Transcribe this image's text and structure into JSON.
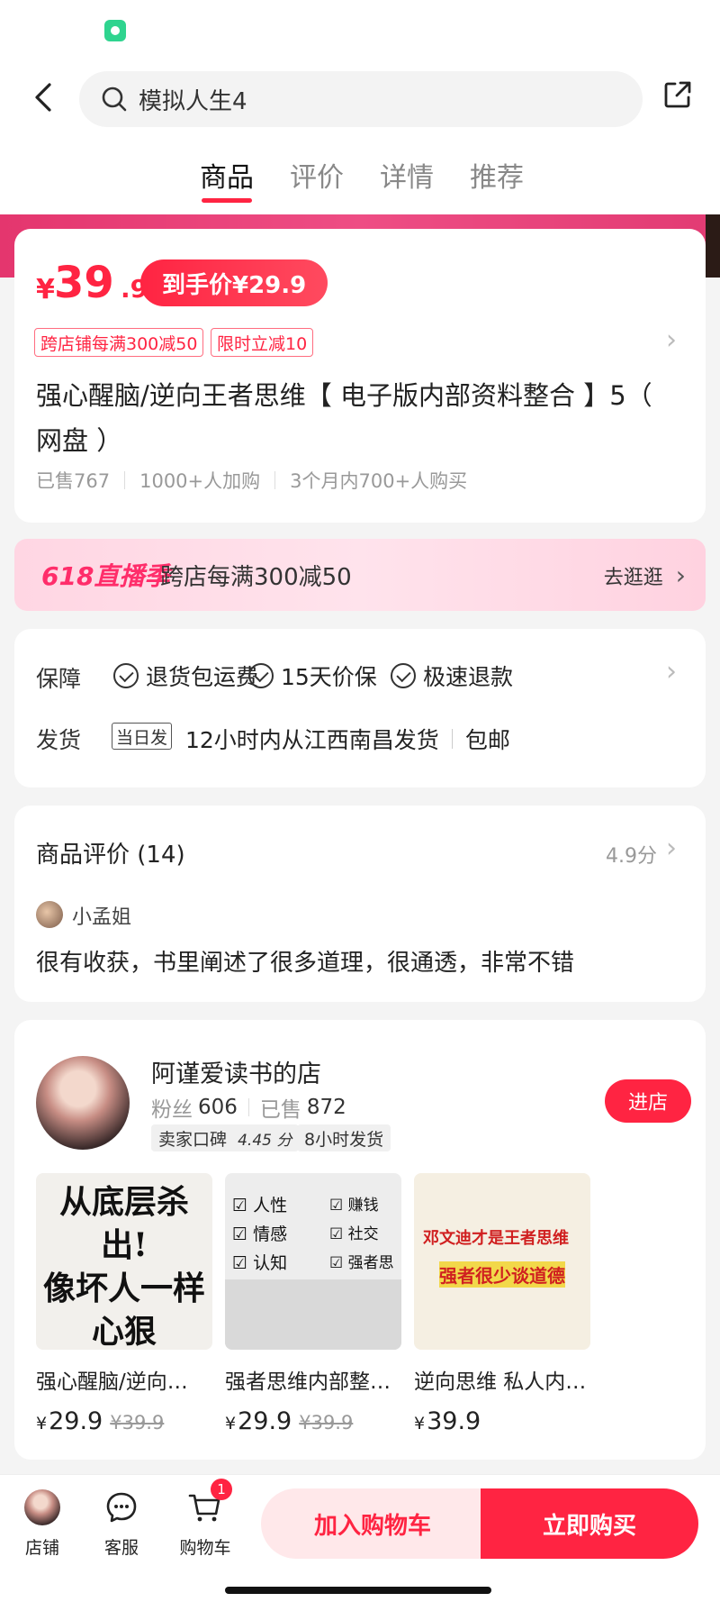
{
  "header": {
    "search_query": "模拟人生4",
    "tabs": [
      "商品",
      "评价",
      "详情",
      "推荐"
    ]
  },
  "price": {
    "currency": "¥",
    "integer": "39",
    "decimal": ".9",
    "final_label": "到手价¥29.9"
  },
  "coupons": [
    "跨店铺每满300减50",
    "限时立减10"
  ],
  "product": {
    "title": "强心醒脑/逆向王者思维【 电子版内部资料整合 】5（ 网盘 ）",
    "stats": [
      "已售767",
      "1000+人加购",
      "3个月内700+人购买"
    ]
  },
  "promo": {
    "logo": "618直播季",
    "text": "跨店每满300减50",
    "action": "去逛逛"
  },
  "guarantee": {
    "label": "保障",
    "items": [
      "退货包运费",
      "15天价保",
      "极速退款"
    ],
    "ship_label": "发货",
    "ship_tag": "当日发",
    "ship_text": "12小时内从江西南昌发货",
    "ship_free": "包邮"
  },
  "review": {
    "heading": "商品评价 (14)",
    "score": "4.9分",
    "reviewer": "小孟姐",
    "text": "很有收获，书里阐述了很多道理，很通透，非常不错"
  },
  "shop": {
    "name": "阿谨爱读书的店",
    "fans_label": "粉丝",
    "fans": "606",
    "sold_label": "已售",
    "sold": "872",
    "tag_reputation": "卖家口碑",
    "reputation_score": "4.45 分",
    "tag_ship": "8小时发货",
    "enter_label": "进店",
    "products": [
      {
        "name": "强心醒脑/逆向…",
        "price": "29.9",
        "old_price": "¥39.9",
        "thumb_lines": [
          "从底层杀出!",
          "像坏人一样",
          "心狠"
        ]
      },
      {
        "name": "强者思维内部整…",
        "price": "29.9",
        "old_price": "¥39.9",
        "thumb_lines": [
          "人性",
          "情感",
          "认知",
          "赚钱",
          "社交",
          "强者思维"
        ]
      },
      {
        "name": "逆向思维 私人内…",
        "price": "39.9",
        "old_price": "",
        "thumb_lines": [
          "邓文迪才是王者思维",
          "强者很少谈道德"
        ]
      }
    ]
  },
  "bottom": {
    "shop_label": "店铺",
    "service_label": "客服",
    "cart_label": "购物车",
    "cart_count": "1",
    "add_cart": "加入购物车",
    "buy_now": "立即购买"
  },
  "colors": {
    "accent": "#ff2442",
    "promo_pink": "#ff2d6a"
  }
}
